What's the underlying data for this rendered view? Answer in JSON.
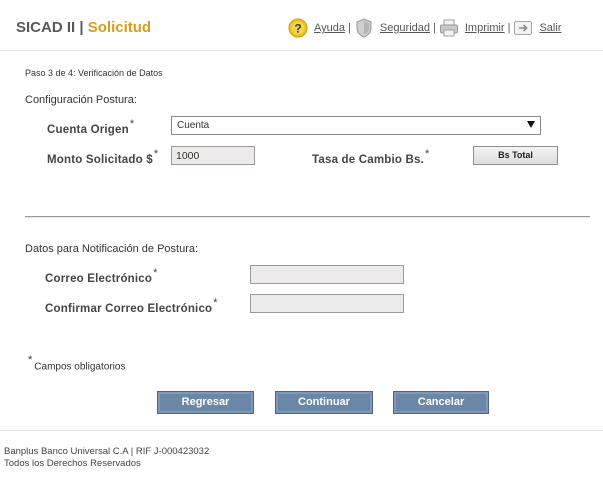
{
  "header": {
    "app_name": "SICAD II",
    "separator": "|",
    "section": "Solicitud",
    "links": [
      {
        "label": "Ayuda",
        "icon": "help-icon"
      },
      {
        "label": "Seguridad",
        "icon": "shield-icon"
      },
      {
        "label": "Imprimir",
        "icon": "printer-icon"
      },
      {
        "label": "Salir",
        "icon": "exit-icon"
      }
    ],
    "link_separator": "|"
  },
  "step": "Paso 3 de 4: Verificación de Datos",
  "config": {
    "heading": "Configuración Postura:",
    "cuenta_origen_label": "Cuenta Origen",
    "cuenta_origen_value": "Cuenta",
    "monto_label": "Monto Solicitado $",
    "monto_value": "1000",
    "tasa_label": "Tasa de Cambio Bs.",
    "bs_total_button": "Bs Total"
  },
  "notification": {
    "heading": "Datos para Notificación de Postura:",
    "email_label": "Correo Electrónico",
    "email_value": "",
    "confirm_email_label": "Confirmar Correo Electrónico",
    "confirm_email_value": ""
  },
  "required_mark": "*",
  "required_note": "Campos obligatorios",
  "actions": {
    "back": "Regresar",
    "continue": "Continuar",
    "cancel": "Cancelar"
  },
  "footer": {
    "line1": "Banplus Banco Universal C.A | RIF J-000423032",
    "line2": "Todos los Derechos Reservados"
  },
  "colors": {
    "brand_accent": "#d99d1b",
    "button_blue": "#6b87a8",
    "title_gray": "#58595b"
  }
}
